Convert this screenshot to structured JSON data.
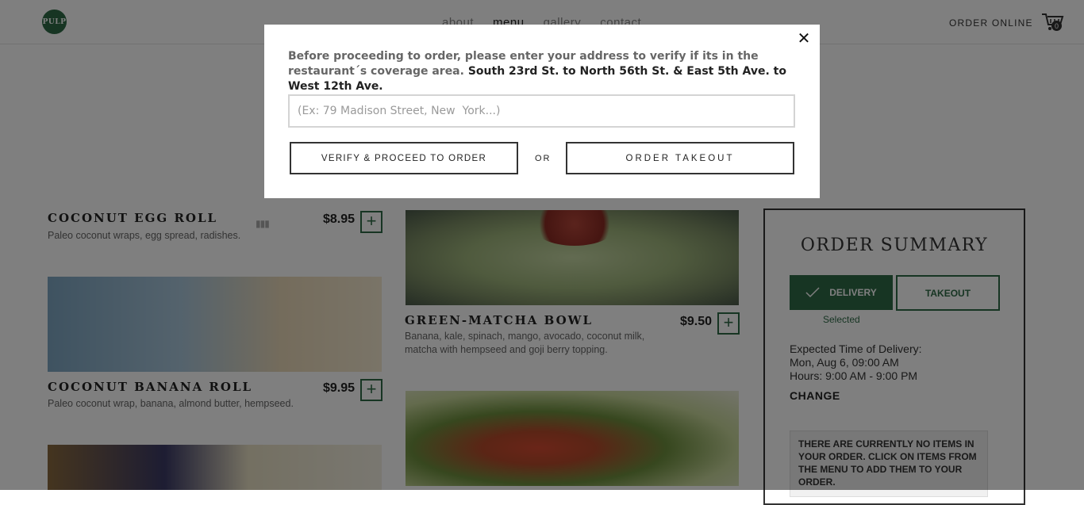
{
  "header": {
    "logo_text": "PULP",
    "nav": [
      "about",
      "menu",
      "gallery",
      "contact"
    ],
    "order_online": "ORDER ONLINE",
    "cart_count": "0"
  },
  "menu_items": [
    {
      "title": "COCONUT EGG ROLL",
      "desc": "Paleo coconut wraps, egg spread, radishes.",
      "price": "$8.95"
    },
    {
      "title": "COCONUT BANANA ROLL",
      "desc": "Paleo coconut wrap, banana, almond butter, hempseed.",
      "price": "$9.95"
    },
    {
      "title": "GREEN-MATCHA BOWL",
      "desc_1": "Banana, kale, spinach, mango, avocado, coconut milk,",
      "desc_2": "matcha with hempseed and goji berry topping.",
      "price": "$9.50"
    }
  ],
  "summary": {
    "title": "ORDER SUMMARY",
    "delivery_label": "DELIVERY",
    "takeout_label": "TAKEOUT",
    "selected": "Selected",
    "expected_label": "Expected Time of Delivery:",
    "expected_date": "Mon, Aug 6, 09:00 AM",
    "hours": "Hours: 9:00 AM - 9:00 PM",
    "change": "CHANGE",
    "empty_message": "THERE ARE CURRENTLY NO ITEMS IN YOUR ORDER. CLICK ON ITEMS FROM THE MENU TO ADD THEM TO YOUR ORDER."
  },
  "modal": {
    "message_lead": "Before proceeding to order, please enter your address to verify if its in the restaurant´s coverage area.",
    "message_area": "South 23rd St. to North 56th St. & East 5th Ave. to West 12th Ave.",
    "address_placeholder": "(Ex: 79 Madison Street, New  York...)",
    "verify_label": "VERIFY & PROCEED TO ORDER",
    "or_label": "OR",
    "takeout_label": "ORDER TAKEOUT",
    "close_symbol": "✕"
  },
  "colors": {
    "brand_green": "#2e6b47",
    "overlay": "rgba(0,0,0,0.5)"
  }
}
